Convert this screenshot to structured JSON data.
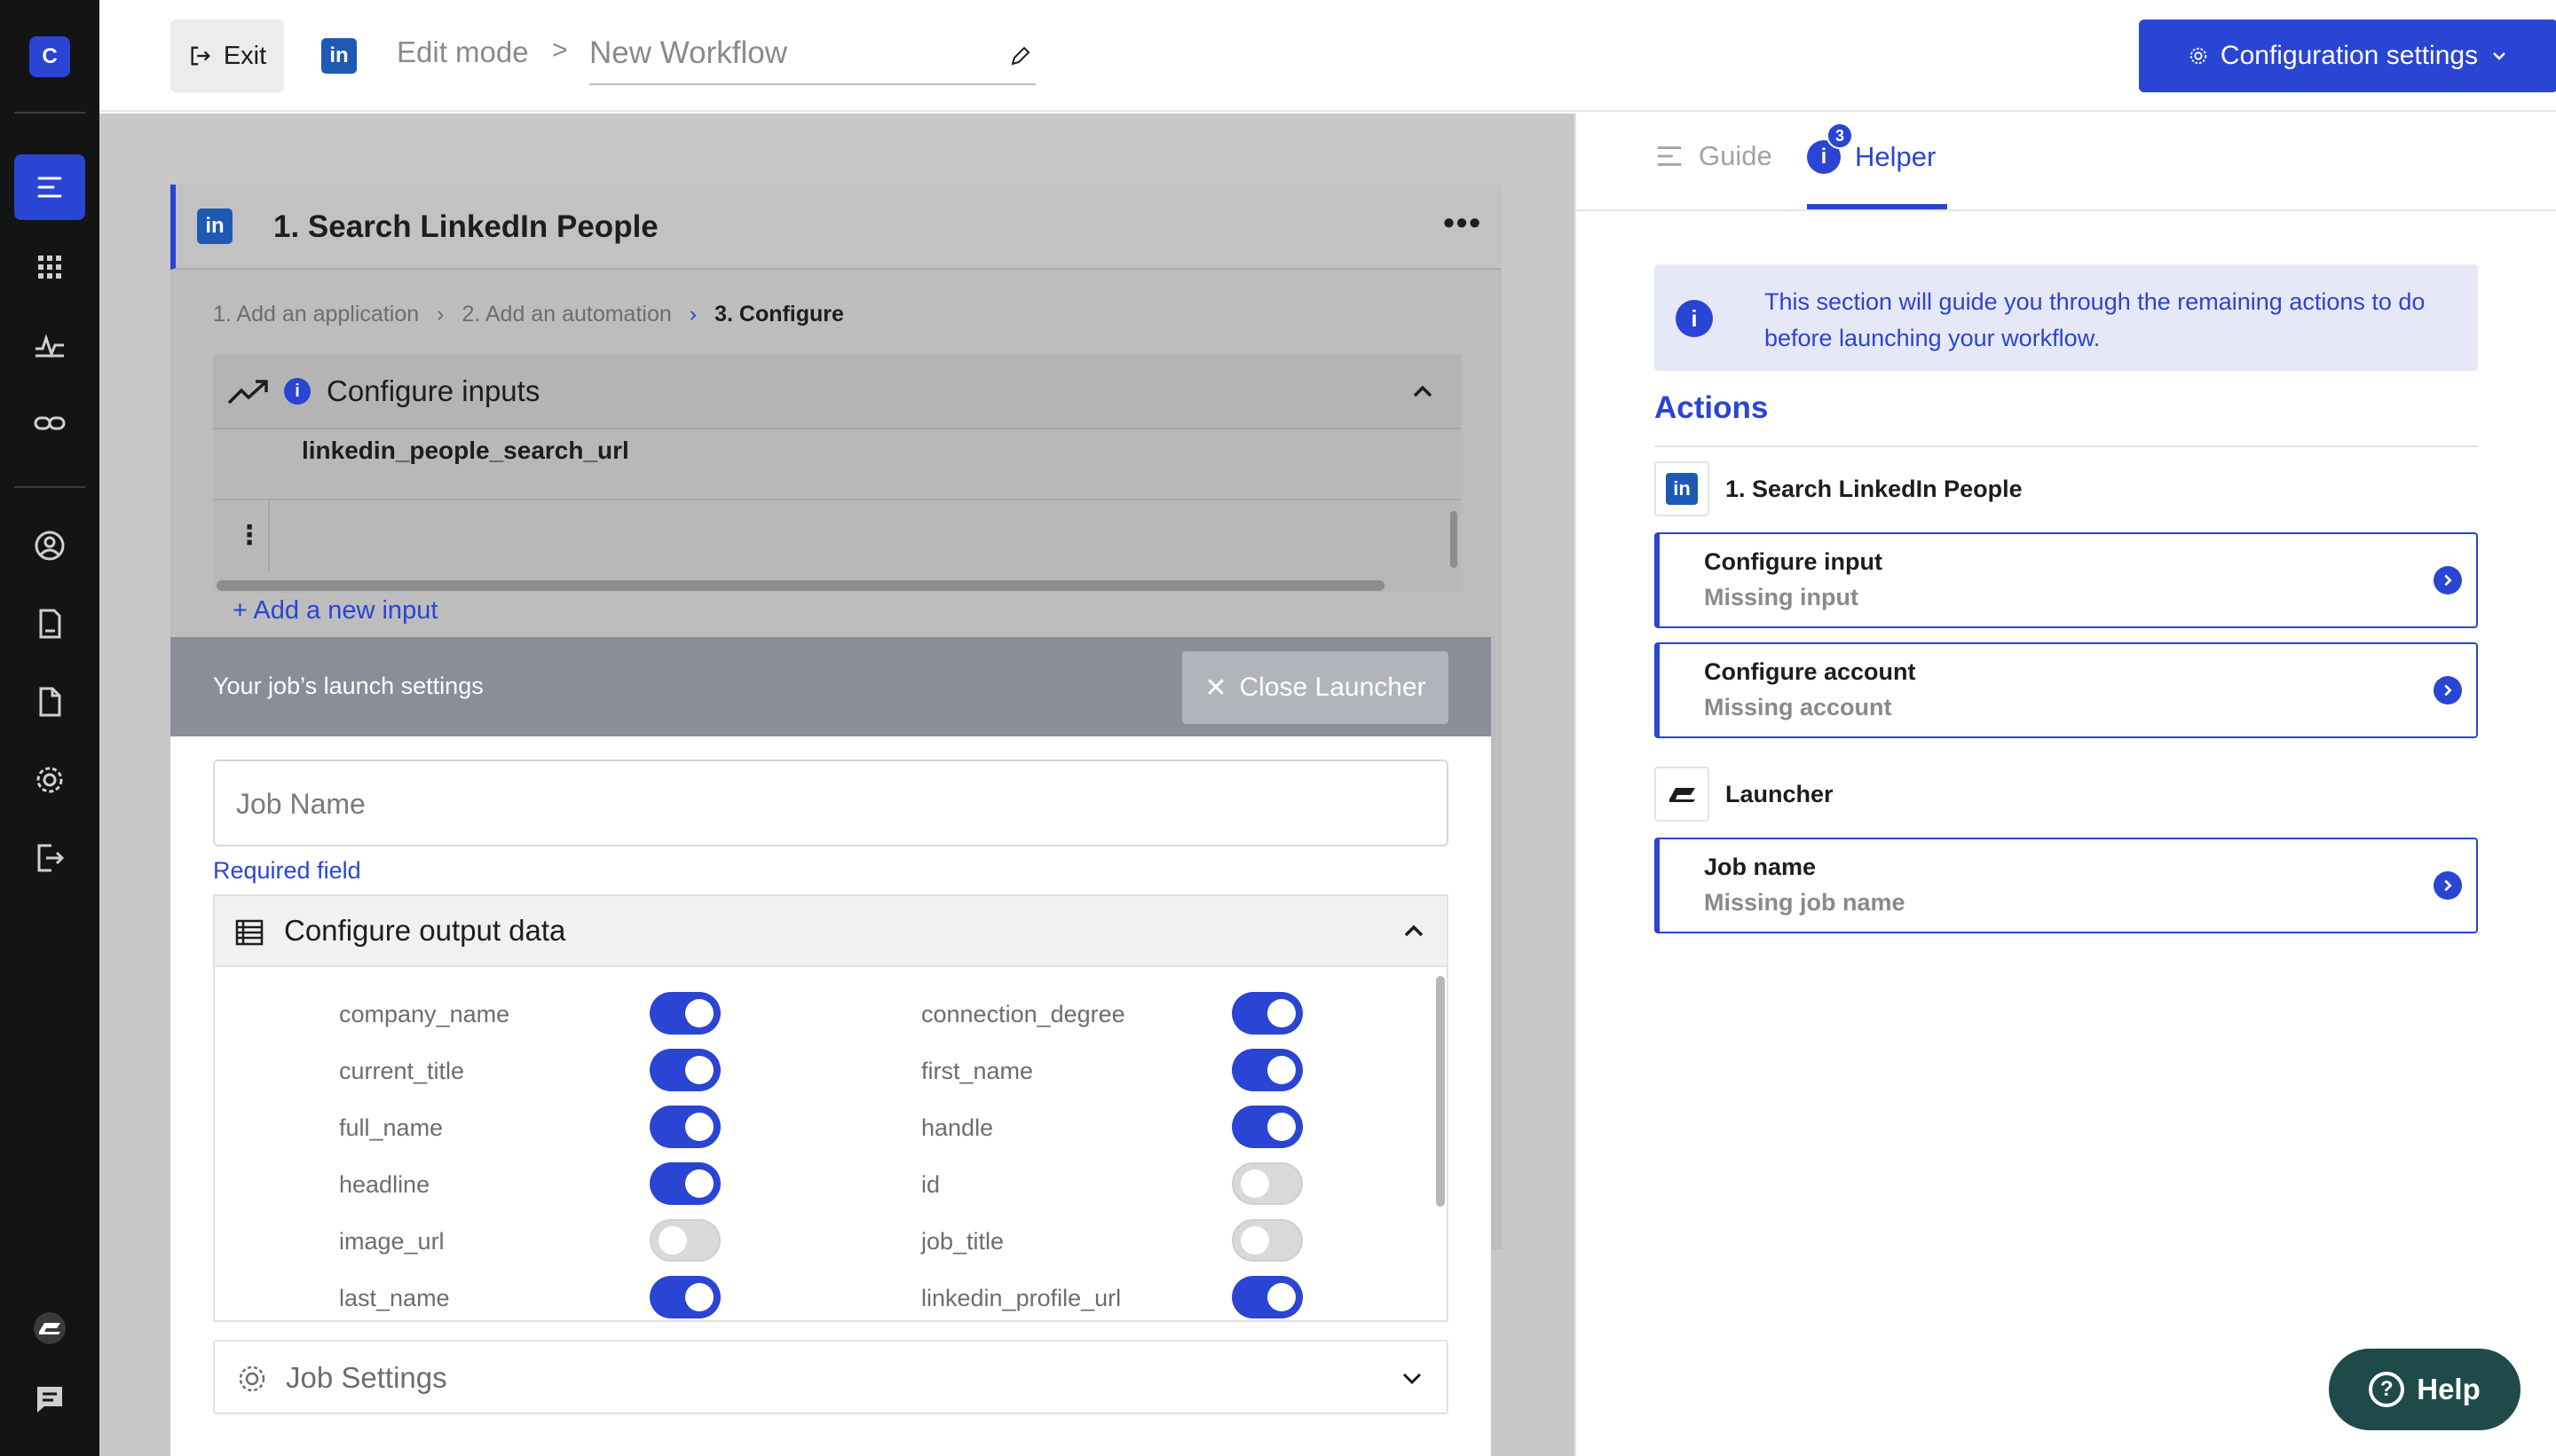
{
  "rail": {
    "logo_letter": "C",
    "items": [
      {
        "icon": "list-icon",
        "active": true
      },
      {
        "icon": "grid-icon",
        "active": false
      },
      {
        "icon": "activity-icon",
        "active": false
      },
      {
        "icon": "link-icon",
        "active": false
      },
      {
        "icon": "user-circle-icon",
        "active": false
      },
      {
        "icon": "document-icon",
        "active": false
      },
      {
        "icon": "file-icon",
        "active": false
      },
      {
        "icon": "gear-icon",
        "active": false
      },
      {
        "icon": "logout-icon",
        "active": false
      },
      {
        "icon": "brand-mark-icon",
        "active": false
      },
      {
        "icon": "chat-icon",
        "active": false
      }
    ],
    "accent_color": "#2a44d4"
  },
  "topbar": {
    "exit_label": "Exit",
    "edit_mode": "Edit mode",
    "crumb_separator": ">",
    "workflow_name": "New Workflow",
    "config_button_label": "Configuration settings"
  },
  "card": {
    "title": "1. Search LinkedIn People",
    "steps": [
      {
        "label": "1. Add an application"
      },
      {
        "label": "2. Add an automation"
      },
      {
        "label": "3. Configure"
      }
    ],
    "configure_inputs": {
      "title": "Configure inputs",
      "column_name": "linkedin_people_search_url",
      "add_input_label": "+ Add a new input"
    }
  },
  "launcher": {
    "title": "Your job’s launch settings",
    "close_label": "Close Launcher",
    "job_name_placeholder": "Job Name",
    "required_text": "Required field",
    "output": {
      "title": "Configure output data",
      "fields": [
        {
          "name": "company_name",
          "enabled": true
        },
        {
          "name": "connection_degree",
          "enabled": true
        },
        {
          "name": "current_title",
          "enabled": true
        },
        {
          "name": "first_name",
          "enabled": true
        },
        {
          "name": "full_name",
          "enabled": true
        },
        {
          "name": "handle",
          "enabled": true
        },
        {
          "name": "headline",
          "enabled": true
        },
        {
          "name": "id",
          "enabled": false
        },
        {
          "name": "image_url",
          "enabled": false
        },
        {
          "name": "job_title",
          "enabled": false
        },
        {
          "name": "last_name",
          "enabled": true
        },
        {
          "name": "linkedin_profile_url",
          "enabled": true
        }
      ]
    },
    "job_settings_label": "Job Settings"
  },
  "rpanel": {
    "tab_guide": "Guide",
    "tab_helper": "Helper",
    "helper_badge": "3",
    "notice": "This section will guide you through the remaining actions to do before launching your workflow.",
    "actions_title": "Actions",
    "groups": [
      {
        "name": "1. Search LinkedIn People",
        "icon": "linkedin-icon",
        "cards": [
          {
            "title": "Configure input",
            "subtitle": "Missing input"
          },
          {
            "title": "Configure account",
            "subtitle": "Missing account"
          }
        ]
      },
      {
        "name": "Launcher",
        "icon": "brand-mark-icon",
        "cards": [
          {
            "title": "Job name",
            "subtitle": "Missing job name"
          }
        ]
      }
    ]
  },
  "help_label": "Help"
}
